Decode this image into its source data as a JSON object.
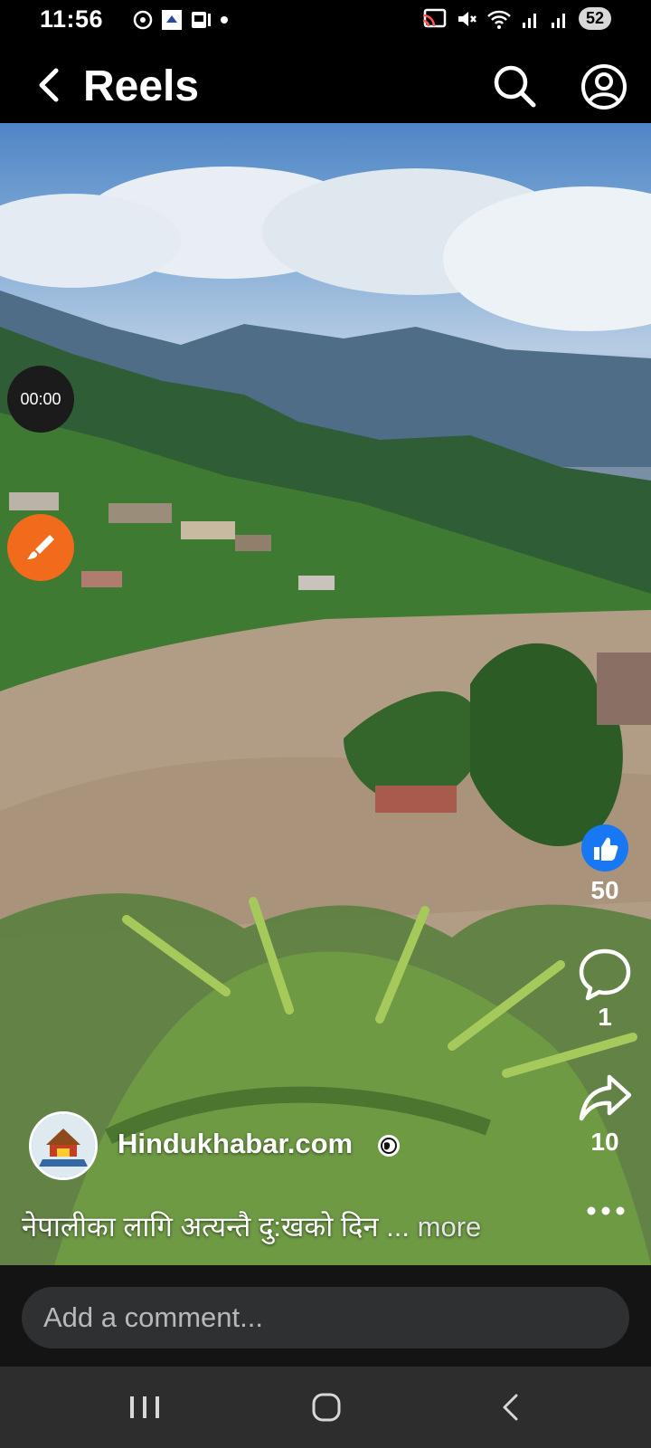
{
  "status_bar": {
    "time": "11:56",
    "battery": "52",
    "left_icons": [
      "chatgpt-icon",
      "app-icon",
      "gallery-icon",
      "dot-icon"
    ],
    "right_icons": [
      "cast-icon",
      "mute-icon",
      "wifi-icon",
      "signal-icon",
      "signal-icon"
    ]
  },
  "header": {
    "title": "Reels"
  },
  "video": {
    "timer": "00:00",
    "scene": "river-flood-landscape"
  },
  "actions": {
    "like_count": "50",
    "comment_count": "1",
    "share_count": "10"
  },
  "post": {
    "page_name": "Hindukhabar.com",
    "caption": "नेपालीका लागि अत्यन्तै दु:खको दिन ...",
    "more_label": "more"
  },
  "comment": {
    "placeholder": "Add a comment..."
  },
  "colors": {
    "like_blue": "#1877f2",
    "brush_orange": "#f26a1b",
    "input_bg": "#2f3032"
  }
}
